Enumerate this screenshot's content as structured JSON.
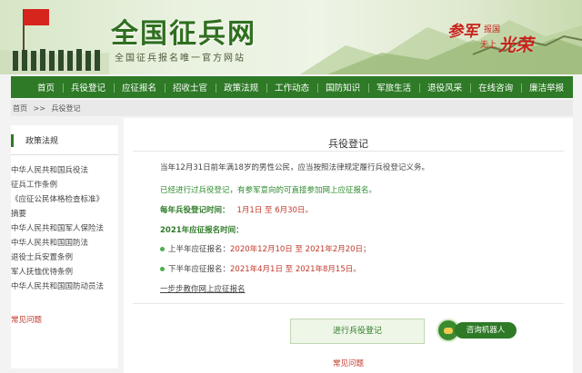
{
  "header": {
    "title": "全国征兵网",
    "subtitle": "全国征兵报名唯一官方网站",
    "slogan": {
      "part1": "参军",
      "part2": "报国",
      "part3": "无上",
      "part4": "光荣"
    }
  },
  "nav": {
    "items": [
      "首页",
      "兵役登记",
      "应征报名",
      "招收士官",
      "政策法规",
      "工作动态",
      "国防知识",
      "军旅生活",
      "退役风采",
      "在线咨询",
      "廉洁举报"
    ]
  },
  "breadcrumb": {
    "home": "首页",
    "sep": ">>",
    "current": "兵役登记"
  },
  "sidebar": {
    "heading": "政策法规",
    "items": [
      "中华人民共和国兵役法",
      "征兵工作条例",
      "《应征公民体格检查标准》",
      "摘要",
      "中华人民共和国军人保险法",
      "中华人民共和国国防法",
      "退役士兵安置条例",
      "军人抚恤优待条例",
      "中华人民共和国国防动员法"
    ],
    "faq": "常见问题"
  },
  "main": {
    "title": "兵役登记",
    "intro": "当年12月31日前年满18岁的男性公民，应当按照法律规定履行兵役登记义务。",
    "green_note": "已经进行过兵役登记，有参军意向的可直接参加网上应征报名。",
    "period_label": "每年兵役登记时间：",
    "period_value": "1月1日 至 6月30日。",
    "year_heading": "2021年应征报名时间：",
    "first_half_label": "上半年应征报名：",
    "first_half_value": "2020年12月10日 至 2021年2月20日；",
    "second_half_label": "下半年应征报名：",
    "second_half_value": "2021年4月1日 至 2021年8月15日。",
    "step_link": "一步步教你网上应征报名",
    "register_button": "进行兵役登记",
    "robot_button": "咨询机器人",
    "faq": "常见问题"
  },
  "colors": {
    "brand_green": "#2e7a27",
    "alert_red": "#c0392b"
  }
}
